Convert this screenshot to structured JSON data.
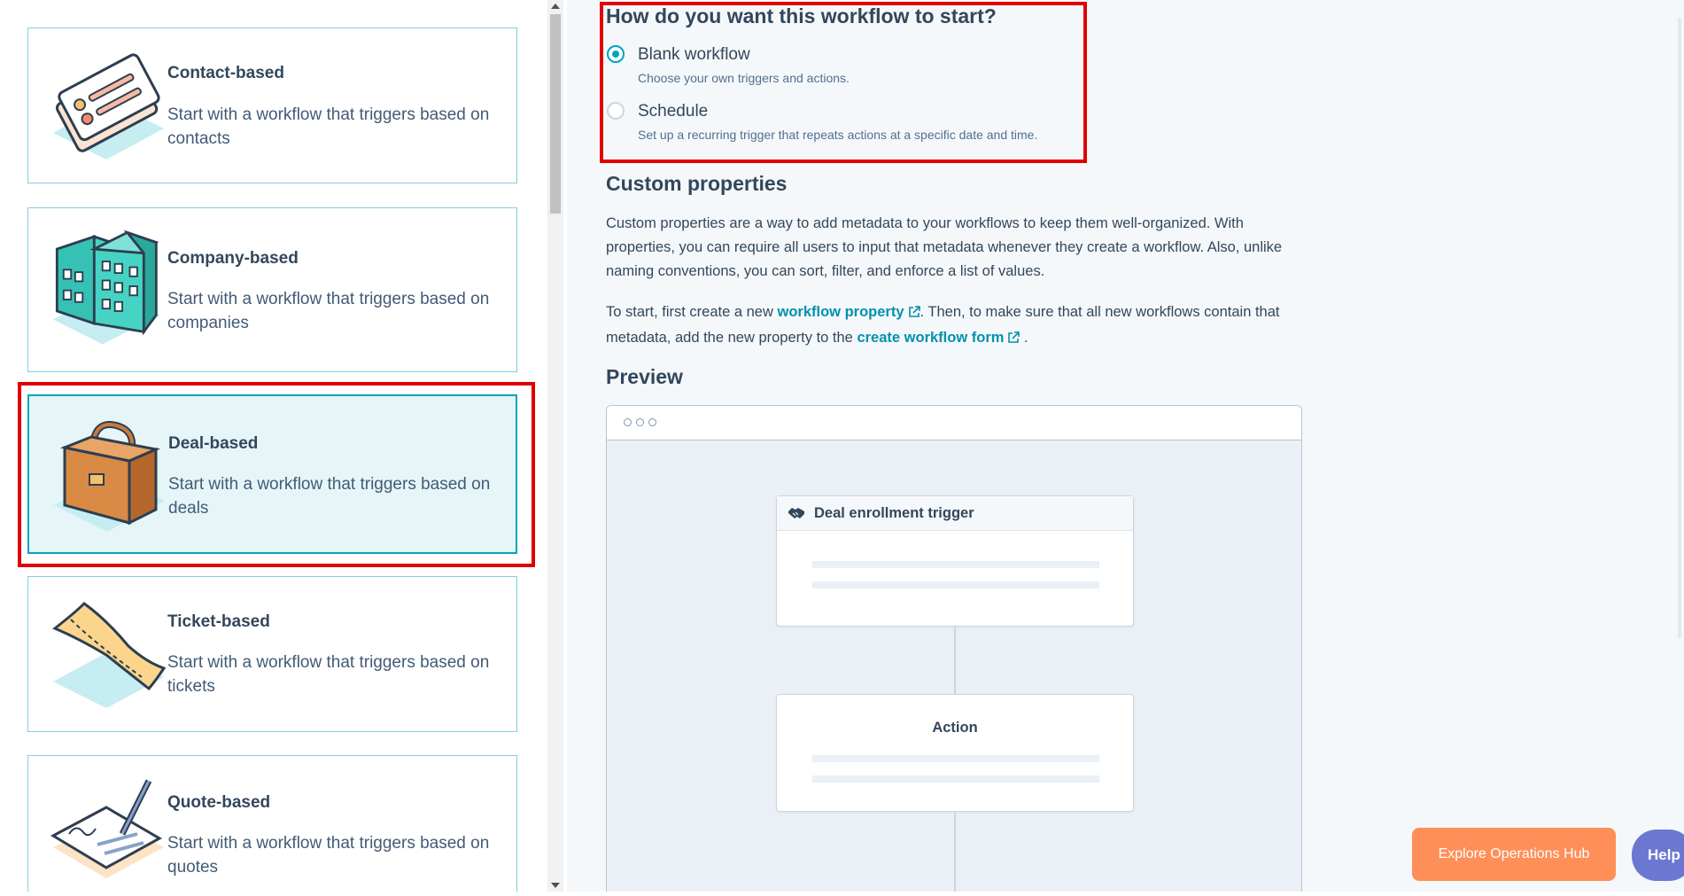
{
  "left_panel": {
    "cards": [
      {
        "title": "Contact-based",
        "description": "Start with a workflow that triggers based on contacts",
        "icon": "contact-cards-illustration"
      },
      {
        "title": "Company-based",
        "description": "Start with a workflow that triggers based on companies",
        "icon": "building-illustration"
      },
      {
        "title": "Deal-based",
        "description": "Start with a workflow that triggers based on deals",
        "icon": "briefcase-illustration"
      },
      {
        "title": "Ticket-based",
        "description": "Start with a workflow that triggers based on tickets",
        "icon": "ticket-illustration"
      },
      {
        "title": "Quote-based",
        "description": "Start with a workflow that triggers based on quotes",
        "icon": "signed-document-illustration"
      }
    ],
    "selected_card": "Deal-based"
  },
  "start_section": {
    "heading": "How do you want this workflow to start?",
    "options": [
      {
        "label": "Blank workflow",
        "help": "Choose your own triggers and actions.",
        "checked": true
      },
      {
        "label": "Schedule",
        "help": "Set up a recurring trigger that repeats actions at a specific date and time.",
        "checked": false
      }
    ]
  },
  "custom_properties": {
    "heading": "Custom properties",
    "paragraph1": "Custom properties are a way to add metadata to your workflows to keep them well-organized. With properties, you can require all users to input that metadata whenever they create a workflow. Also, unlike naming conventions, you can sort, filter, and enforce a list of values.",
    "p2_before": "To start, first create a new",
    "p2_link1": "workflow property",
    "p2_middle": ". Then, to make sure that all new workflows contain that metadata, add the new property to the",
    "p2_link2": "create workflow form",
    "p2_end": "."
  },
  "preview": {
    "heading": "Preview",
    "trigger_title": "Deal enrollment trigger",
    "action_title": "Action"
  },
  "footer": {
    "explore_label": "Explore Operations Hub",
    "help_label": "Help"
  },
  "colors": {
    "accent": "#00a4bd",
    "highlight": "#e00000",
    "explore_button": "#ff8f59",
    "help_button": "#6a78d1"
  }
}
